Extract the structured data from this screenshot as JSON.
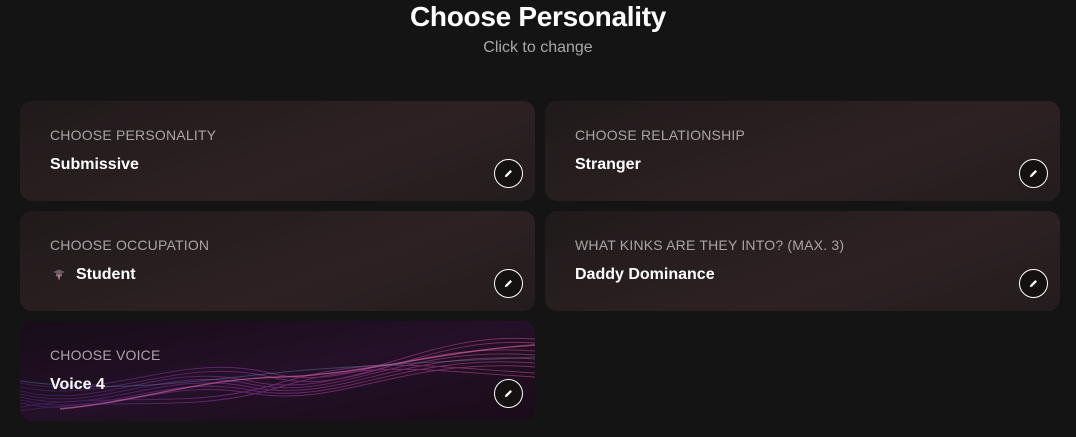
{
  "header": {
    "title": "Choose Personality",
    "subtitle": "Click to change"
  },
  "cards": [
    {
      "label": "CHOOSE PERSONALITY",
      "value": "Submissive"
    },
    {
      "label": "CHOOSE RELATIONSHIP",
      "value": "Stranger"
    },
    {
      "label": "CHOOSE OCCUPATION",
      "value": "Student",
      "icon": "graduation-cap-icon"
    },
    {
      "label": "WHAT KINKS ARE THEY INTO? (MAX. 3)",
      "value": "Daddy Dominance"
    },
    {
      "label": "CHOOSE VOICE",
      "value": "Voice 4"
    }
  ],
  "edit_icon": "pencil-icon",
  "colors": {
    "background": "#141414",
    "card": "#251d1f",
    "label": "#a9a4a5",
    "voice_wave_purple": "#8a3aa8",
    "voice_wave_pink": "#c04a8a"
  }
}
